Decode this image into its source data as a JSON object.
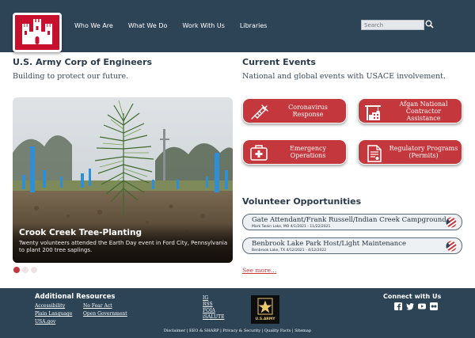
{
  "header": {
    "nav": [
      "Who We Are",
      "What We Do",
      "Work With Us",
      "Libraries"
    ],
    "search_placeholder": "Search"
  },
  "intro": {
    "title": "U.S. Army Corp of Engineers",
    "tagline": "Building to protect our future."
  },
  "hero": {
    "title": "Crook Creek Tree-Planting",
    "text": "Twenty volunteers attended the Earth Day event in Ford City, Pennsylvania to plant 200 tree saplings.",
    "slide_count": 3,
    "active_slide": 1
  },
  "events": {
    "title": "Current Events",
    "tagline": "National and global events with USACE involvement.",
    "buttons": [
      {
        "label": "Coronavirus Response",
        "icon": "syringe-icon"
      },
      {
        "label": "Afgan National Contractor Assistance",
        "icon": "crane-building-icon"
      },
      {
        "label": "Emergency Operations",
        "icon": "first-aid-kit-icon"
      },
      {
        "label": "Regulatory Programs (Permits)",
        "icon": "permit-document-icon"
      }
    ]
  },
  "volunteer": {
    "title": "Volunteer Opportunities",
    "items": [
      {
        "title": "Gate Attendant/Frank Russell/Indian Creek Campground",
        "subtitle": "Mark Twain Lake, MO  4/1/2021 - 11/22/2021"
      },
      {
        "title": "Benbrook Lake Park Host/Light Maintenance",
        "subtitle": "Benbrook Lake, TX  4/12/2021 - 4/12/2022"
      }
    ],
    "see_more": "See more..."
  },
  "footer": {
    "resources_title": "Additional Resources",
    "resources_col1": [
      "Accessibility",
      "Plain Language",
      "USA.gov"
    ],
    "resources_col2": [
      "No Fear Act",
      "Open Government"
    ],
    "resources_col3": [
      "IG",
      "RSS",
      "FOIA",
      "iSALUTE"
    ],
    "badge_text": "U.S.ARMY",
    "connect_title": "Connect with Us",
    "social_icons": [
      "facebook-icon",
      "twitter-icon",
      "youtube-icon",
      "flickr-icon"
    ],
    "legal": "Disclaimer | EEO & SHARP | Privacy & Security | Quality Facts | Sitemap"
  },
  "colors": {
    "navy": "#2d4457",
    "red": "#c4373c",
    "logo_red": "#c8102e"
  }
}
